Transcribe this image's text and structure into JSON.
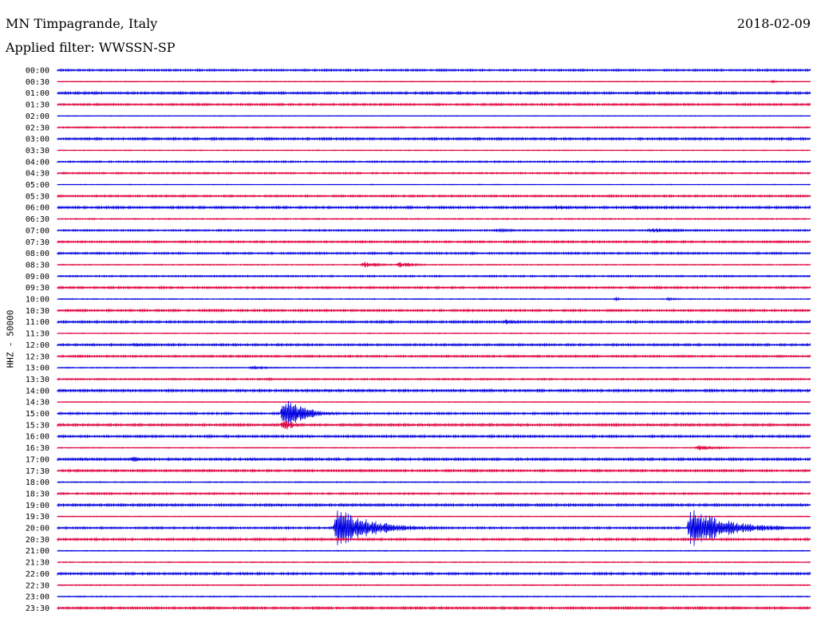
{
  "header": {
    "station": "MN Timpagrande, Italy",
    "date": "2018-02-09",
    "filter": "Applied filter: WWSSN-SP"
  },
  "colors": {
    "trace_even": "#0000e0",
    "trace_odd": "#e0003c",
    "background": "#ffffff",
    "text": "#000000"
  },
  "chart_data": {
    "type": "line",
    "subtype": "helicorder",
    "title": "MN Timpagrande, Italy",
    "ylabel": "HHZ - 50000",
    "time_labels": [
      "00:00",
      "00:30",
      "01:00",
      "01:30",
      "02:00",
      "02:30",
      "03:00",
      "03:30",
      "04:00",
      "04:30",
      "05:00",
      "05:30",
      "06:00",
      "06:30",
      "07:00",
      "07:30",
      "08:00",
      "08:30",
      "09:00",
      "09:30",
      "10:00",
      "10:30",
      "11:00",
      "11:30",
      "12:00",
      "12:30",
      "13:00",
      "13:30",
      "14:00",
      "14:30",
      "15:00",
      "15:30",
      "16:00",
      "16:30",
      "17:00",
      "17:30",
      "18:00",
      "18:30",
      "19:00",
      "19:30",
      "20:00",
      "20:30",
      "21:00",
      "21:30",
      "22:00",
      "22:30",
      "23:00",
      "23:30"
    ],
    "row_minutes": 30,
    "x_range_minutes": [
      0,
      30
    ],
    "trace_colors_alternate": [
      "#0000e0",
      "#e0003c"
    ],
    "noise_levels": [
      1.2,
      0.5,
      1.4,
      1.2,
      0.4,
      0.9,
      1.4,
      0.5,
      1.0,
      1.0,
      0.4,
      1.2,
      1.4,
      0.7,
      1.0,
      1.2,
      1.2,
      0.6,
      1.0,
      1.3,
      0.6,
      1.3,
      1.4,
      0.5,
      1.3,
      1.2,
      0.6,
      1.0,
      1.5,
      0.5,
      1.3,
      1.5,
      1.4,
      0.6,
      1.5,
      1.3,
      0.6,
      1.1,
      1.5,
      0.5,
      1.3,
      1.4,
      0.5,
      0.6,
      1.4,
      0.6,
      0.6,
      1.4
    ],
    "events": [
      {
        "row": 1,
        "minute": 28.4,
        "amp": 2,
        "duration": 0.2
      },
      {
        "row": 2,
        "minute": 18.6,
        "amp": 2,
        "duration": 0.3
      },
      {
        "row": 12,
        "minute": 19.7,
        "amp": 3,
        "duration": 1.0
      },
      {
        "row": 12,
        "minute": 22.8,
        "amp": 3,
        "duration": 0.8
      },
      {
        "row": 14,
        "minute": 17.4,
        "amp": 2,
        "duration": 1.2
      },
      {
        "row": 14,
        "minute": 23.5,
        "amp": 3,
        "duration": 1.4
      },
      {
        "row": 17,
        "minute": 12.1,
        "amp": 4,
        "duration": 0.6
      },
      {
        "row": 17,
        "minute": 13.5,
        "amp": 4,
        "duration": 0.6
      },
      {
        "row": 20,
        "minute": 22.1,
        "amp": 2,
        "duration": 0.3
      },
      {
        "row": 20,
        "minute": 24.2,
        "amp": 2,
        "duration": 0.4
      },
      {
        "row": 22,
        "minute": 17.7,
        "amp": 3,
        "duration": 1.0
      },
      {
        "row": 24,
        "minute": 2.9,
        "amp": 3,
        "duration": 0.6
      },
      {
        "row": 26,
        "minute": 7.6,
        "amp": 2,
        "duration": 0.9
      },
      {
        "row": 27,
        "minute": 8.2,
        "amp": 2,
        "duration": 0.5
      },
      {
        "row": 30,
        "minute": 8.9,
        "amp": 21,
        "duration": 0.8
      },
      {
        "row": 31,
        "minute": 8.9,
        "amp": 8,
        "duration": 0.4
      },
      {
        "row": 33,
        "minute": 25.4,
        "amp": 3,
        "duration": 1.0
      },
      {
        "row": 34,
        "minute": 2.9,
        "amp": 4,
        "duration": 0.4
      },
      {
        "row": 40,
        "minute": 11.0,
        "amp": 25,
        "duration": 1.4
      },
      {
        "row": 40,
        "minute": 25.1,
        "amp": 25,
        "duration": 1.5
      },
      {
        "row": 40,
        "minute": 28.5,
        "amp": 3,
        "duration": 0.8
      }
    ]
  }
}
